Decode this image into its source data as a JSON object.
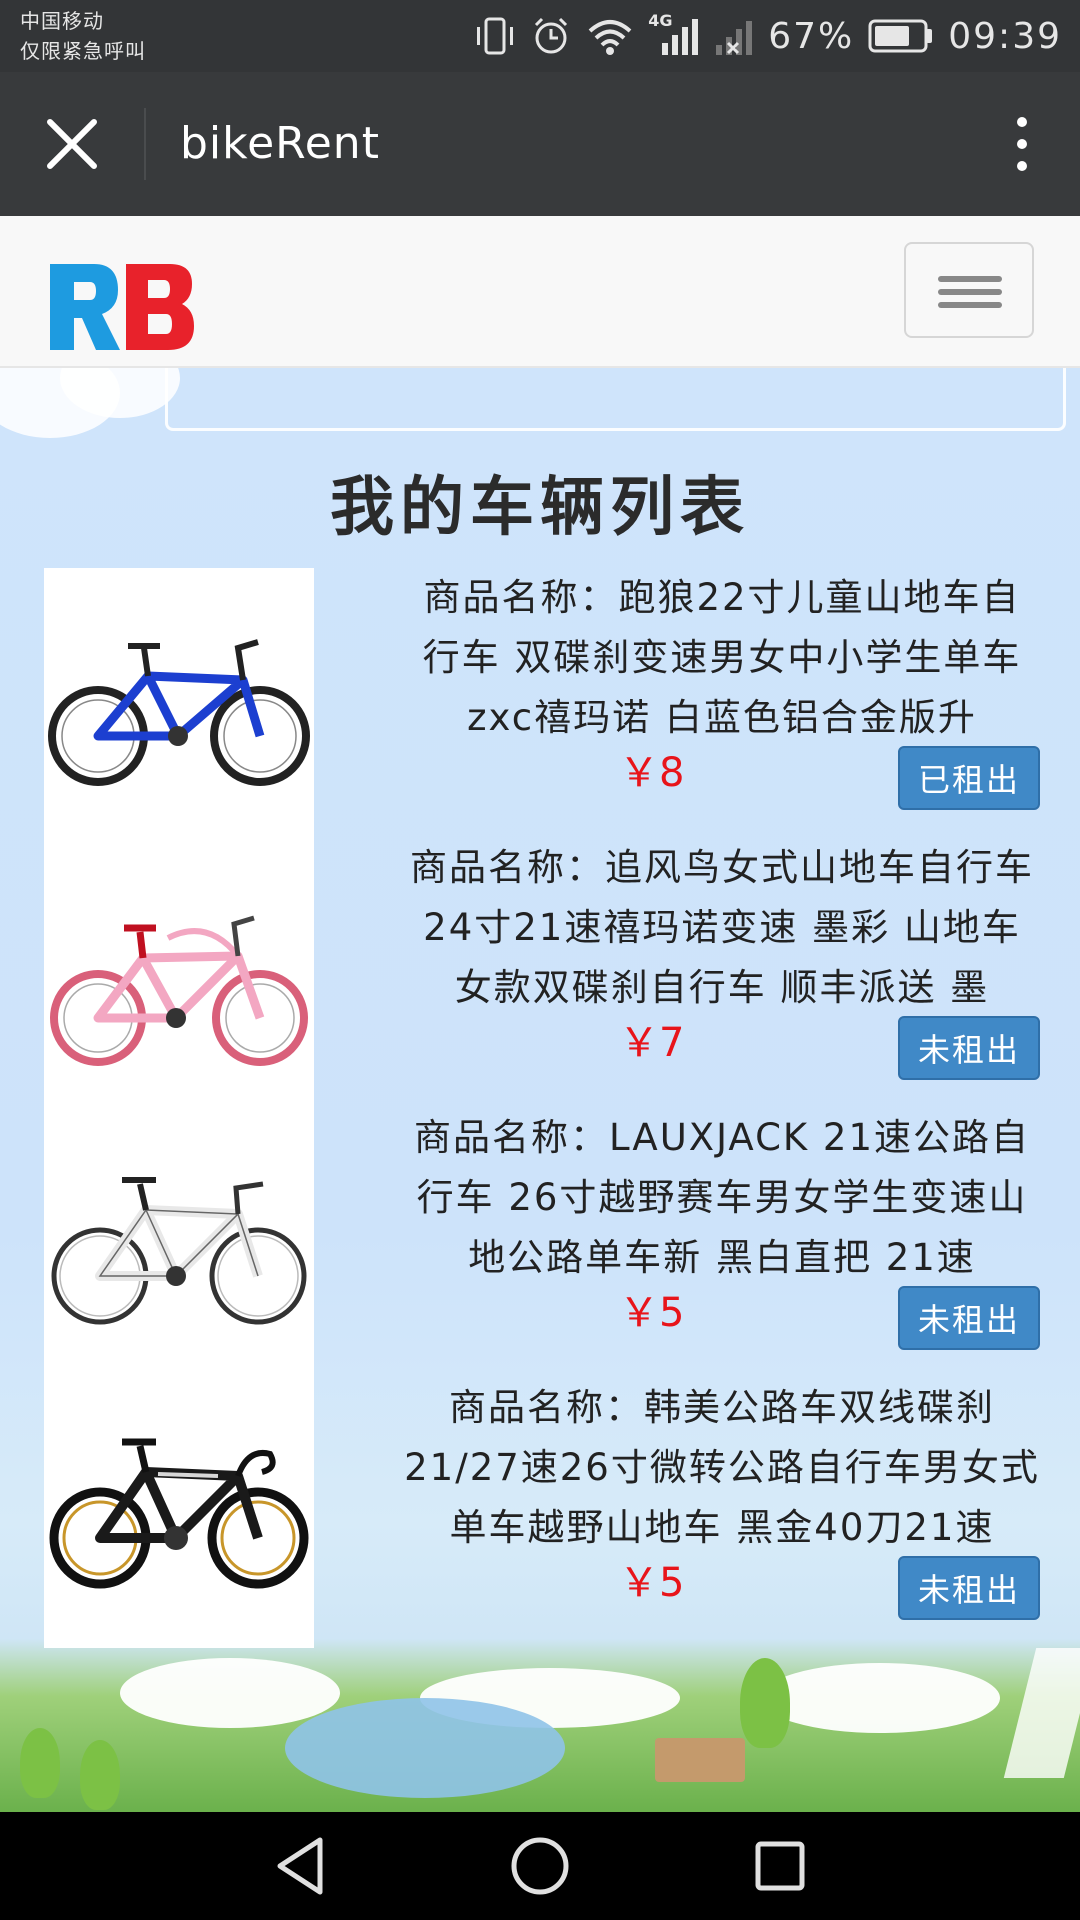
{
  "status_bar": {
    "carrier_line1": "中国移动",
    "carrier_line2": "仅限紧急呼叫",
    "network": "4G",
    "battery_percent": "67%",
    "time": "09:39"
  },
  "app_bar": {
    "title": "bikeRent"
  },
  "header": {
    "logo_text": "RB"
  },
  "main": {
    "title": "我的车辆列表",
    "items": [
      {
        "name": "商品名称：跑狼22寸儿童山地车自行车 双碟刹变速男女中小学生单车zxc禧玛诺 白蓝色铝合金版升",
        "price": "￥8",
        "status": "已租出",
        "image": "blue-mountain-bike"
      },
      {
        "name": "商品名称：追风鸟女式山地车自行车24寸21速禧玛诺变速 墨彩 山地车女款双碟刹自行车 顺丰派送 墨",
        "price": "￥7",
        "status": "未租出",
        "image": "pink-mountain-bike"
      },
      {
        "name": "商品名称：LAUXJACK 21速公路自行车 26寸越野赛车男女学生变速山地公路单车新 黑白直把 21速",
        "price": "￥5",
        "status": "未租出",
        "image": "white-road-bike"
      },
      {
        "name": "商品名称：韩美公路车双线碟刹21/27速26寸微转公路自行车男女式单车越野山地车 黑金40刀21速",
        "price": "￥5",
        "status": "未租出",
        "image": "black-gold-road-bike"
      }
    ]
  },
  "colors": {
    "status_bar_bg": "#333537",
    "app_bar_bg": "#383a3c",
    "button_blue": "#4089c7",
    "price_red": "#e8141a",
    "logo_blue": "#1e9be0",
    "logo_red": "#e8222b"
  },
  "icons": {
    "close": "close-icon",
    "more": "more-vertical-icon",
    "menu": "hamburger-menu-icon",
    "back": "back-triangle-icon",
    "home": "home-circle-icon",
    "recents": "recents-square-icon"
  }
}
